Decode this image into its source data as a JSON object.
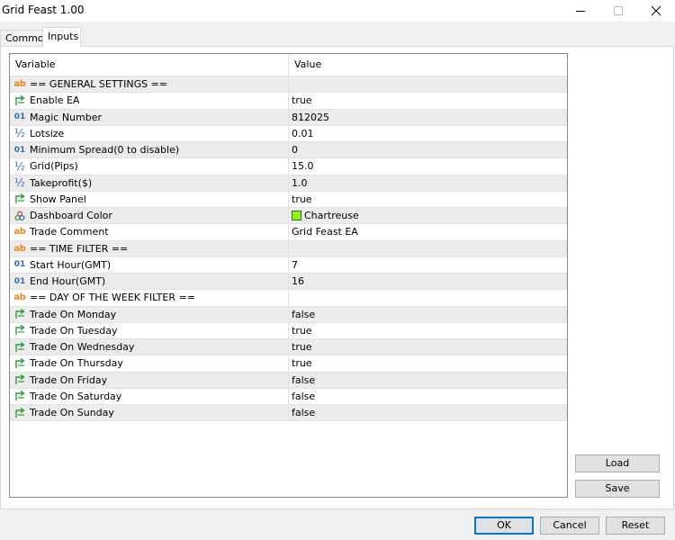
{
  "window": {
    "title": "Grid Feast 1.00"
  },
  "tabs": [
    {
      "label": "Common"
    },
    {
      "label": "Inputs"
    }
  ],
  "grid": {
    "columns": {
      "variable": "Variable",
      "value": "Value"
    },
    "rows": [
      {
        "icon": "ab",
        "name": "== GENERAL SETTINGS ==",
        "value": ""
      },
      {
        "icon": "bool",
        "name": "Enable EA",
        "value": "true"
      },
      {
        "icon": "int",
        "name": "Magic Number",
        "value": "812025"
      },
      {
        "icon": "double",
        "name": "Lotsize",
        "value": "0.01"
      },
      {
        "icon": "int",
        "name": "Minimum Spread(0 to disable)",
        "value": "0"
      },
      {
        "icon": "double",
        "name": "Grid(Pips)",
        "value": "15.0"
      },
      {
        "icon": "double",
        "name": "Takeprofit($)",
        "value": "1.0"
      },
      {
        "icon": "bool",
        "name": "Show Panel",
        "value": "true"
      },
      {
        "icon": "color",
        "name": "Dashboard Color",
        "value": "Chartreuse",
        "swatch": "#7fff00"
      },
      {
        "icon": "ab",
        "name": "Trade Comment",
        "value": "Grid Feast EA"
      },
      {
        "icon": "ab",
        "name": "== TIME FILTER ==",
        "value": ""
      },
      {
        "icon": "int",
        "name": "Start Hour(GMT)",
        "value": "7"
      },
      {
        "icon": "int",
        "name": "End Hour(GMT)",
        "value": "16"
      },
      {
        "icon": "ab",
        "name": "== DAY OF THE WEEK FILTER ==",
        "value": ""
      },
      {
        "icon": "bool",
        "name": "Trade On Monday",
        "value": "false"
      },
      {
        "icon": "bool",
        "name": "Trade On Tuesday",
        "value": "true"
      },
      {
        "icon": "bool",
        "name": "Trade On Wednesday",
        "value": "true"
      },
      {
        "icon": "bool",
        "name": "Trade On Thursday",
        "value": "true"
      },
      {
        "icon": "bool",
        "name": "Trade On Friday",
        "value": "false"
      },
      {
        "icon": "bool",
        "name": "Trade On Saturday",
        "value": "false"
      },
      {
        "icon": "bool",
        "name": "Trade On Sunday",
        "value": "false"
      }
    ]
  },
  "buttons": {
    "load": "Load",
    "save": "Save",
    "ok": "OK",
    "cancel": "Cancel",
    "reset": "Reset"
  },
  "colors": {
    "ab_icon": "#e08a1e",
    "int_icon": "#2f6fb5",
    "bool_icon": "#2e9e3e"
  }
}
